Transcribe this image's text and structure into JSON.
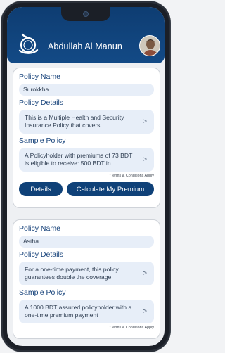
{
  "header": {
    "user_name": "Abdullah Al Manun"
  },
  "policies": [
    {
      "name_label": "Policy Name",
      "name": "Surokkha",
      "details_label": "Policy Details",
      "details": "This is a Multiple Health and Security Insurance Policy that covers",
      "sample_label": "Sample Policy",
      "sample": "A Policyholder with premiums of 73 BDT is eligible to receive: 500 BDT in",
      "terms": "*Terms & Conditions Apply",
      "details_button": "Details",
      "calc_button": "Calculate My Premium"
    },
    {
      "name_label": "Policy Name",
      "name": "Astha",
      "details_label": "Policy Details",
      "details": "For a one-time payment, this policy guarantees double the coverage",
      "sample_label": "Sample Policy",
      "sample": "A 1000 BDT assured policyholder with a one-time premium payment",
      "terms": "*Terms & Conditions Apply"
    }
  ],
  "icons": {
    "chevron": ">"
  },
  "colors": {
    "brand": "#0f4178",
    "header": "#134a86",
    "field_bg": "#e7eef8"
  }
}
